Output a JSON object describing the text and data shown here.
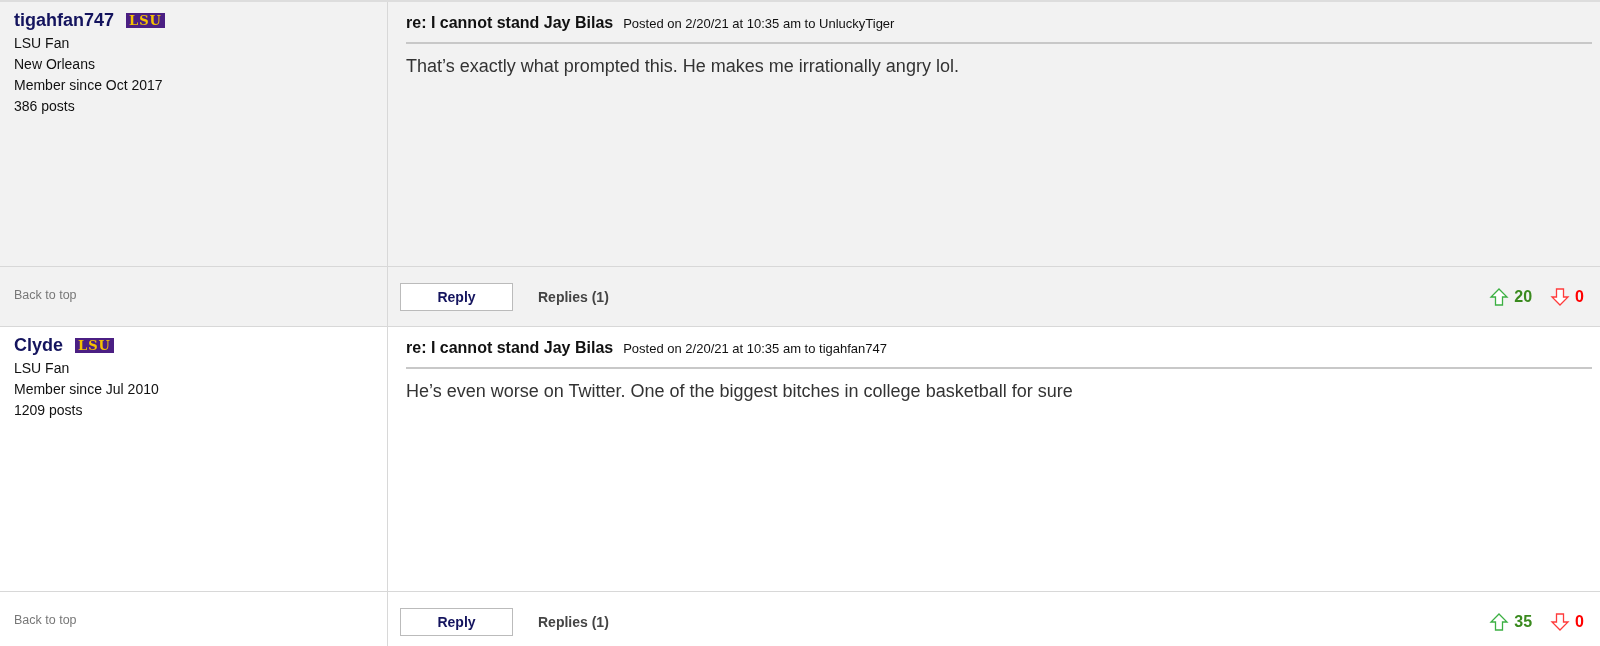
{
  "posts": [
    {
      "shaded": true,
      "author": {
        "username": "tigahfan747",
        "team_logo": "LSU",
        "info": [
          "LSU Fan",
          "New Orleans",
          "Member since Oct 2017",
          "386 posts"
        ]
      },
      "title": "re: I cannot stand Jay Bilas",
      "meta": "Posted on 2/20/21 at 10:35 am to UnluckyTiger",
      "body": "That’s exactly what prompted this. He makes me irrationally angry lol.",
      "back_to_top": "Back to top",
      "reply_button": "Reply",
      "replies_link": "Replies (1)",
      "upvotes": "20",
      "downvotes": "0"
    },
    {
      "shaded": false,
      "author": {
        "username": "Clyde",
        "team_logo": "LSU",
        "info": [
          "LSU Fan",
          "Member since Jul 2010",
          "1209 posts"
        ]
      },
      "title": "re: I cannot stand Jay Bilas",
      "meta": "Posted on 2/20/21 at 10:35 am to tigahfan747",
      "body": "He’s even worse on Twitter. One of the biggest bitches in college basketball for sure",
      "back_to_top": "Back to top",
      "reply_button": "Reply",
      "replies_link": "Replies (1)",
      "upvotes": "35",
      "downvotes": "0"
    }
  ]
}
